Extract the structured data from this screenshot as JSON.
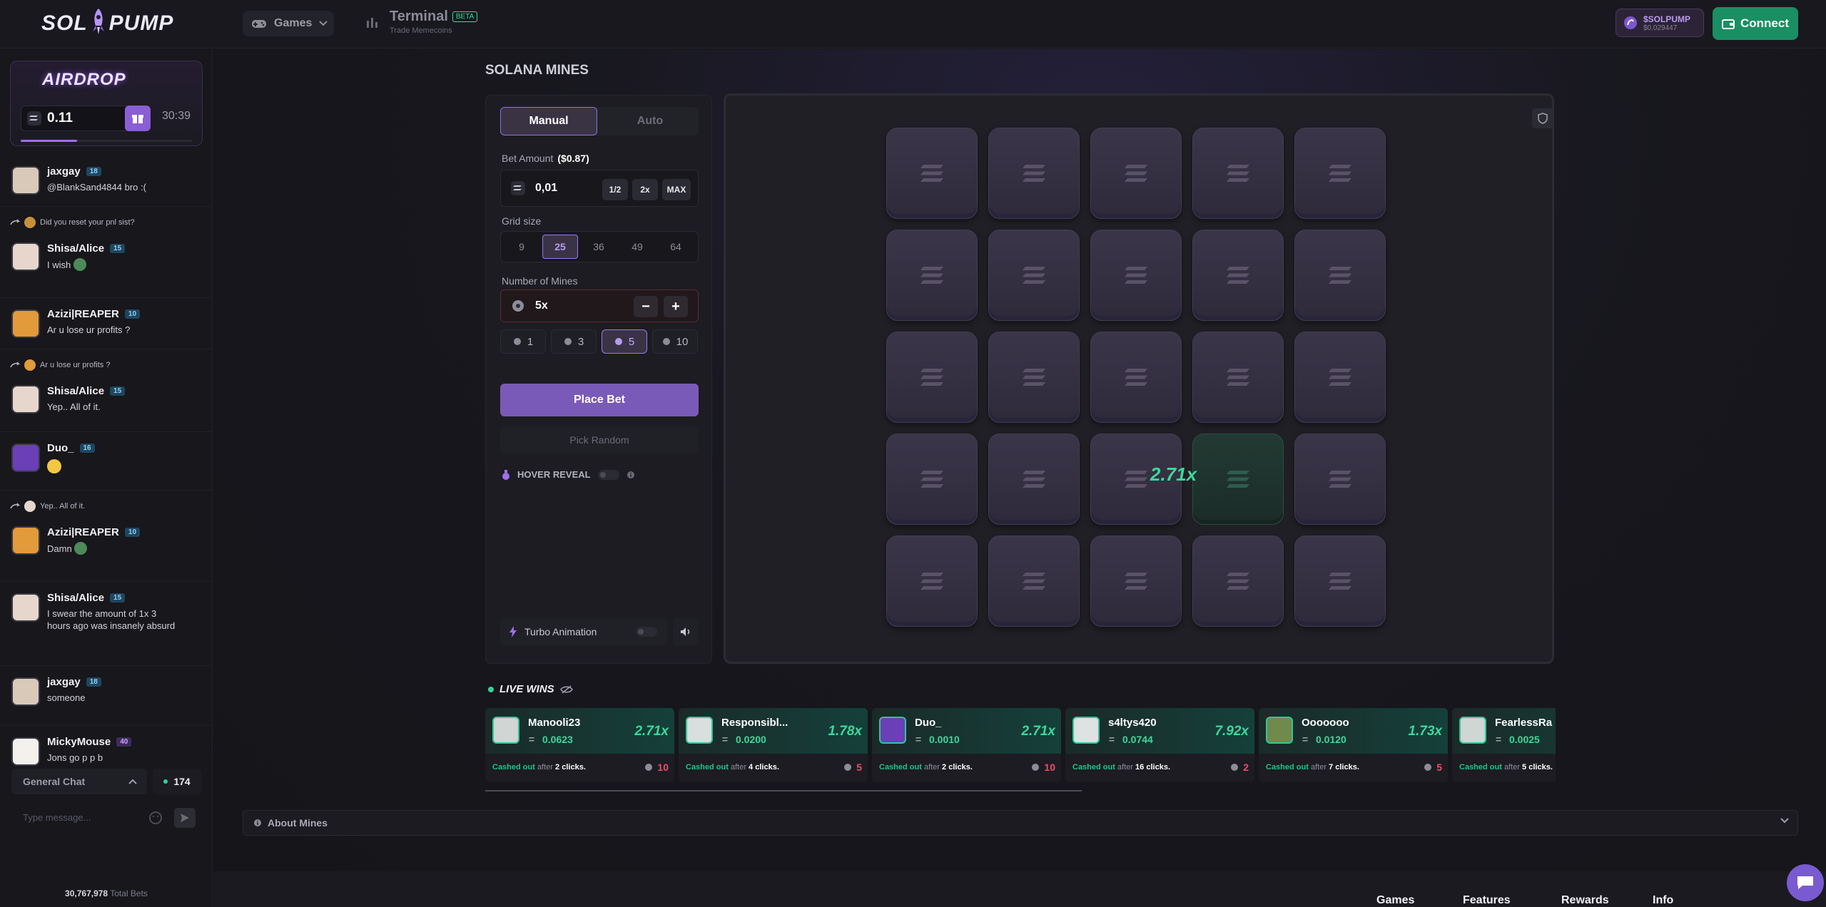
{
  "header": {
    "logo_left": "SOL",
    "logo_right": "PUMP",
    "games_label": "Games",
    "terminal_title": "Terminal",
    "terminal_badge": "BETA",
    "terminal_sub": "Trade Memecoins",
    "token_name": "$SOLPUMP",
    "token_price": "$0.029447",
    "connect_label": "Connect"
  },
  "airdrop": {
    "title": "AIRDROP",
    "amount": "0.11",
    "timer": "30:39",
    "progress": 0.33
  },
  "chat": {
    "messages": [
      {
        "reply": "",
        "name": "jaxgay",
        "level": "18",
        "text": "@BlankSand4844 bro :("
      },
      {
        "reply": "Did you reset your pnl sist?",
        "name": "Shisa/Alice",
        "level": "15",
        "text": "I wish"
      },
      {
        "reply": "",
        "name": "Azizi|REAPER",
        "level": "10",
        "text": "Ar u lose ur profits ?"
      },
      {
        "reply": "Ar u lose ur profits ?",
        "name": "Shisa/Alice",
        "level": "15",
        "text": "Yep.. All of it."
      },
      {
        "reply": "",
        "name": "Duo_",
        "level": "16",
        "text": ""
      },
      {
        "reply": "Yep.. All of it.",
        "name": "Azizi|REAPER",
        "level": "10",
        "text": "Damn"
      },
      {
        "reply": "",
        "name": "Shisa/Alice",
        "level": "15",
        "text": "I swear the amount of 1x 3 hours ago was insanely absurd"
      },
      {
        "reply": "",
        "name": "jaxgay",
        "level": "18",
        "text": "someone"
      },
      {
        "reply": "",
        "name": "MickyMouse",
        "level": "40",
        "text": "Jons go p p b"
      }
    ],
    "channel": "General Chat",
    "online": "174",
    "input_placeholder": "Type message...",
    "total_bets": "30,767,978",
    "total_bets_label": "Total Bets"
  },
  "game": {
    "title": "SOLANA MINES",
    "tab_manual": "Manual",
    "tab_auto": "Auto",
    "bet_label": "Bet Amount",
    "bet_usd": "($0.87)",
    "bet_value": "0,01",
    "half": "1/2",
    "double": "2x",
    "max": "MAX",
    "grid_label": "Grid size",
    "grid_sizes": [
      "9",
      "25",
      "36",
      "49",
      "64"
    ],
    "mines_label": "Number of Mines",
    "mines_value": "5x",
    "minus": "−",
    "plus": "+",
    "mine_quick": [
      "1",
      "3",
      "5",
      "10"
    ],
    "place_bet": "Place Bet",
    "pick_random": "Pick Random",
    "hover_reveal": "HOVER REVEAL",
    "turbo": "Turbo Animation",
    "multiplier": "2.71x"
  },
  "live_wins": {
    "title": "LIVE WINS",
    "cashed_prefix": "Cashed out",
    "after": "after",
    "clicks_suffix": "clicks.",
    "items": [
      {
        "name": "Manooli23",
        "amount": "0.0623",
        "mult": "2.71x",
        "clicks": "2",
        "mines": "10"
      },
      {
        "name": "Responsibl...",
        "amount": "0.0200",
        "mult": "1.78x",
        "clicks": "4",
        "mines": "5"
      },
      {
        "name": "Duo_",
        "amount": "0.0010",
        "mult": "2.71x",
        "clicks": "2",
        "mines": "10"
      },
      {
        "name": "s4ltys420",
        "amount": "0.0744",
        "mult": "7.92x",
        "clicks": "16",
        "mines": "2"
      },
      {
        "name": "Ooooooo",
        "amount": "0.0120",
        "mult": "1.73x",
        "clicks": "7",
        "mines": "5"
      },
      {
        "name": "FearlessRa",
        "amount": "0.0025",
        "mult": "",
        "clicks": "5",
        "mines": ""
      }
    ]
  },
  "about": "About Mines",
  "footer": [
    "Games",
    "Features",
    "Rewards",
    "Info"
  ],
  "colors": {
    "accent": "#7a5ab8",
    "green": "#3fd79b",
    "danger": "#ef4b6a"
  }
}
